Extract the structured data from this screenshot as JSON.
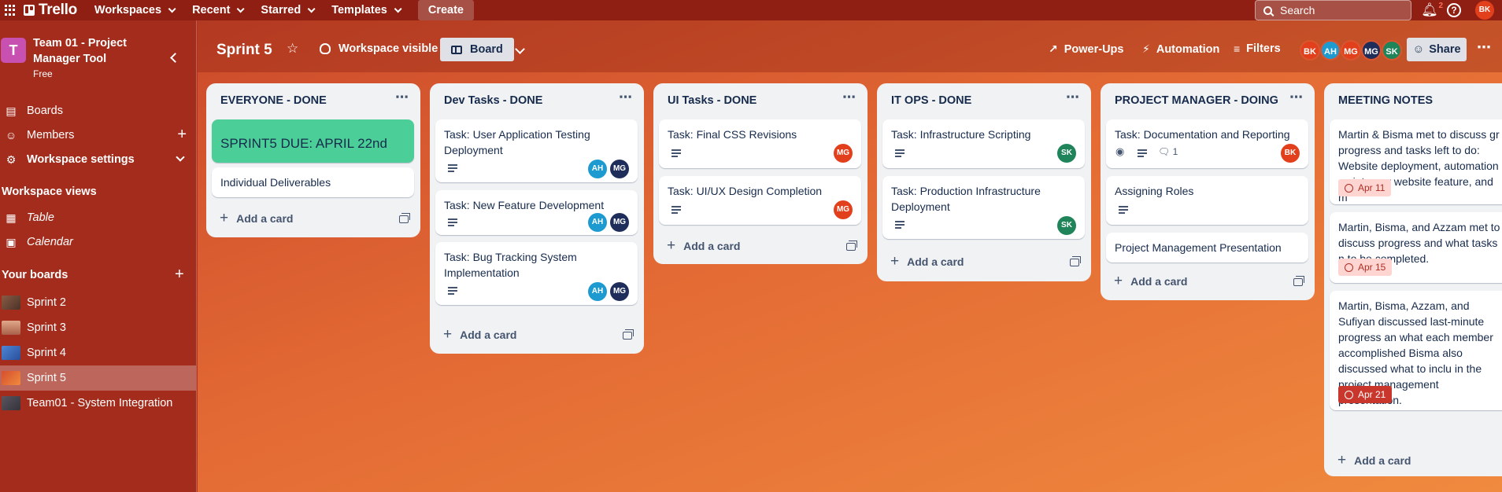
{
  "topbar": {
    "brand": "Trello",
    "nav": [
      "Workspaces",
      "Recent",
      "Starred",
      "Templates"
    ],
    "create": "Create",
    "search_placeholder": "Search",
    "notification_count": "2",
    "help": "?",
    "user_initials": "BK"
  },
  "sidebar": {
    "workspace_initial": "T",
    "workspace_name": "Team 01 - Project Manager Tool",
    "workspace_plan": "Free",
    "items": [
      {
        "label": "Boards"
      },
      {
        "label": "Members"
      },
      {
        "label": "Workspace settings"
      }
    ],
    "views_heading": "Workspace views",
    "views": [
      {
        "label": "Table"
      },
      {
        "label": "Calendar"
      }
    ],
    "boards_heading": "Your boards",
    "boards": [
      {
        "label": "Sprint 2",
        "color": "#6b4a3a"
      },
      {
        "label": "Sprint 3",
        "color": "#c98a6a"
      },
      {
        "label": "Sprint 4",
        "color": "#3b6fc2"
      },
      {
        "label": "Sprint 5",
        "color": "#e56a35"
      },
      {
        "label": "Team01 - System Integration",
        "color": "#4a4a55"
      }
    ]
  },
  "board": {
    "title": "Sprint 5",
    "visibility": "Workspace visible",
    "view": "Board",
    "powerups": "Power-Ups",
    "automation": "Automation",
    "filters": "Filters",
    "members": [
      {
        "initials": "BK",
        "color": "#e2401c"
      },
      {
        "initials": "AH",
        "color": "#1d9bd1"
      },
      {
        "initials": "MG",
        "color": "#e2401c"
      },
      {
        "initials": "MG",
        "color": "#1f2d5a"
      },
      {
        "initials": "SK",
        "color": "#1f845a"
      }
    ],
    "share": "Share"
  },
  "lists": [
    {
      "title": "EVERYONE - DONE",
      "add_card": "Add a card",
      "cards": [
        {
          "title": "SPRINT5 DUE: APRIL 22nd"
        },
        {
          "title": "Individual Deliverables"
        }
      ]
    },
    {
      "title": "Dev Tasks - DONE",
      "add_card": "Add a card",
      "cards": [
        {
          "title": "Task: User Application Testing Deployment",
          "members": [
            "AH",
            "MG"
          ]
        },
        {
          "title": "Task: New Feature Development",
          "members": [
            "AH",
            "MG"
          ]
        },
        {
          "title": "Task: Bug Tracking System Implementation",
          "members": [
            "AH",
            "MG"
          ]
        }
      ]
    },
    {
      "title": "UI Tasks - DONE",
      "add_card": "Add a card",
      "cards": [
        {
          "title": "Task: Final CSS Revisions",
          "members": [
            "MG"
          ]
        },
        {
          "title": "Task: UI/UX Design Completion",
          "members": [
            "MG"
          ]
        }
      ]
    },
    {
      "title": "IT OPS - DONE",
      "add_card": "Add a card",
      "cards": [
        {
          "title": "Task: Infrastructure Scripting",
          "members": [
            "SK"
          ]
        },
        {
          "title": "Task: Production Infrastructure Deployment",
          "members": [
            "SK"
          ]
        }
      ]
    },
    {
      "title": "PROJECT MANAGER - DOING",
      "add_card": "Add a card",
      "cards": [
        {
          "title": "Task: Documentation and Reporting",
          "comments": "1",
          "members": [
            "BK"
          ]
        },
        {
          "title": "Assigning Roles"
        },
        {
          "title": "Project Management Presentation"
        }
      ]
    },
    {
      "title": "MEETING NOTES",
      "add_card": "Add a card",
      "cards": [
        {
          "title": "Martin & Bisma met to discuss gr progress and tasks left to do: Website deployment, automation script, new website feature, and m",
          "date": "Apr 11"
        },
        {
          "title": "Martin, Bisma, and Azzam met to discuss progress and what tasks n to be completed.",
          "date": "Apr 15"
        },
        {
          "title": "Martin, Bisma, Azzam, and Sufiyan discussed last-minute progress an what each member accomplished Bisma also discussed what to inclu in the project management presentation.",
          "date": "Apr 21"
        }
      ]
    }
  ]
}
